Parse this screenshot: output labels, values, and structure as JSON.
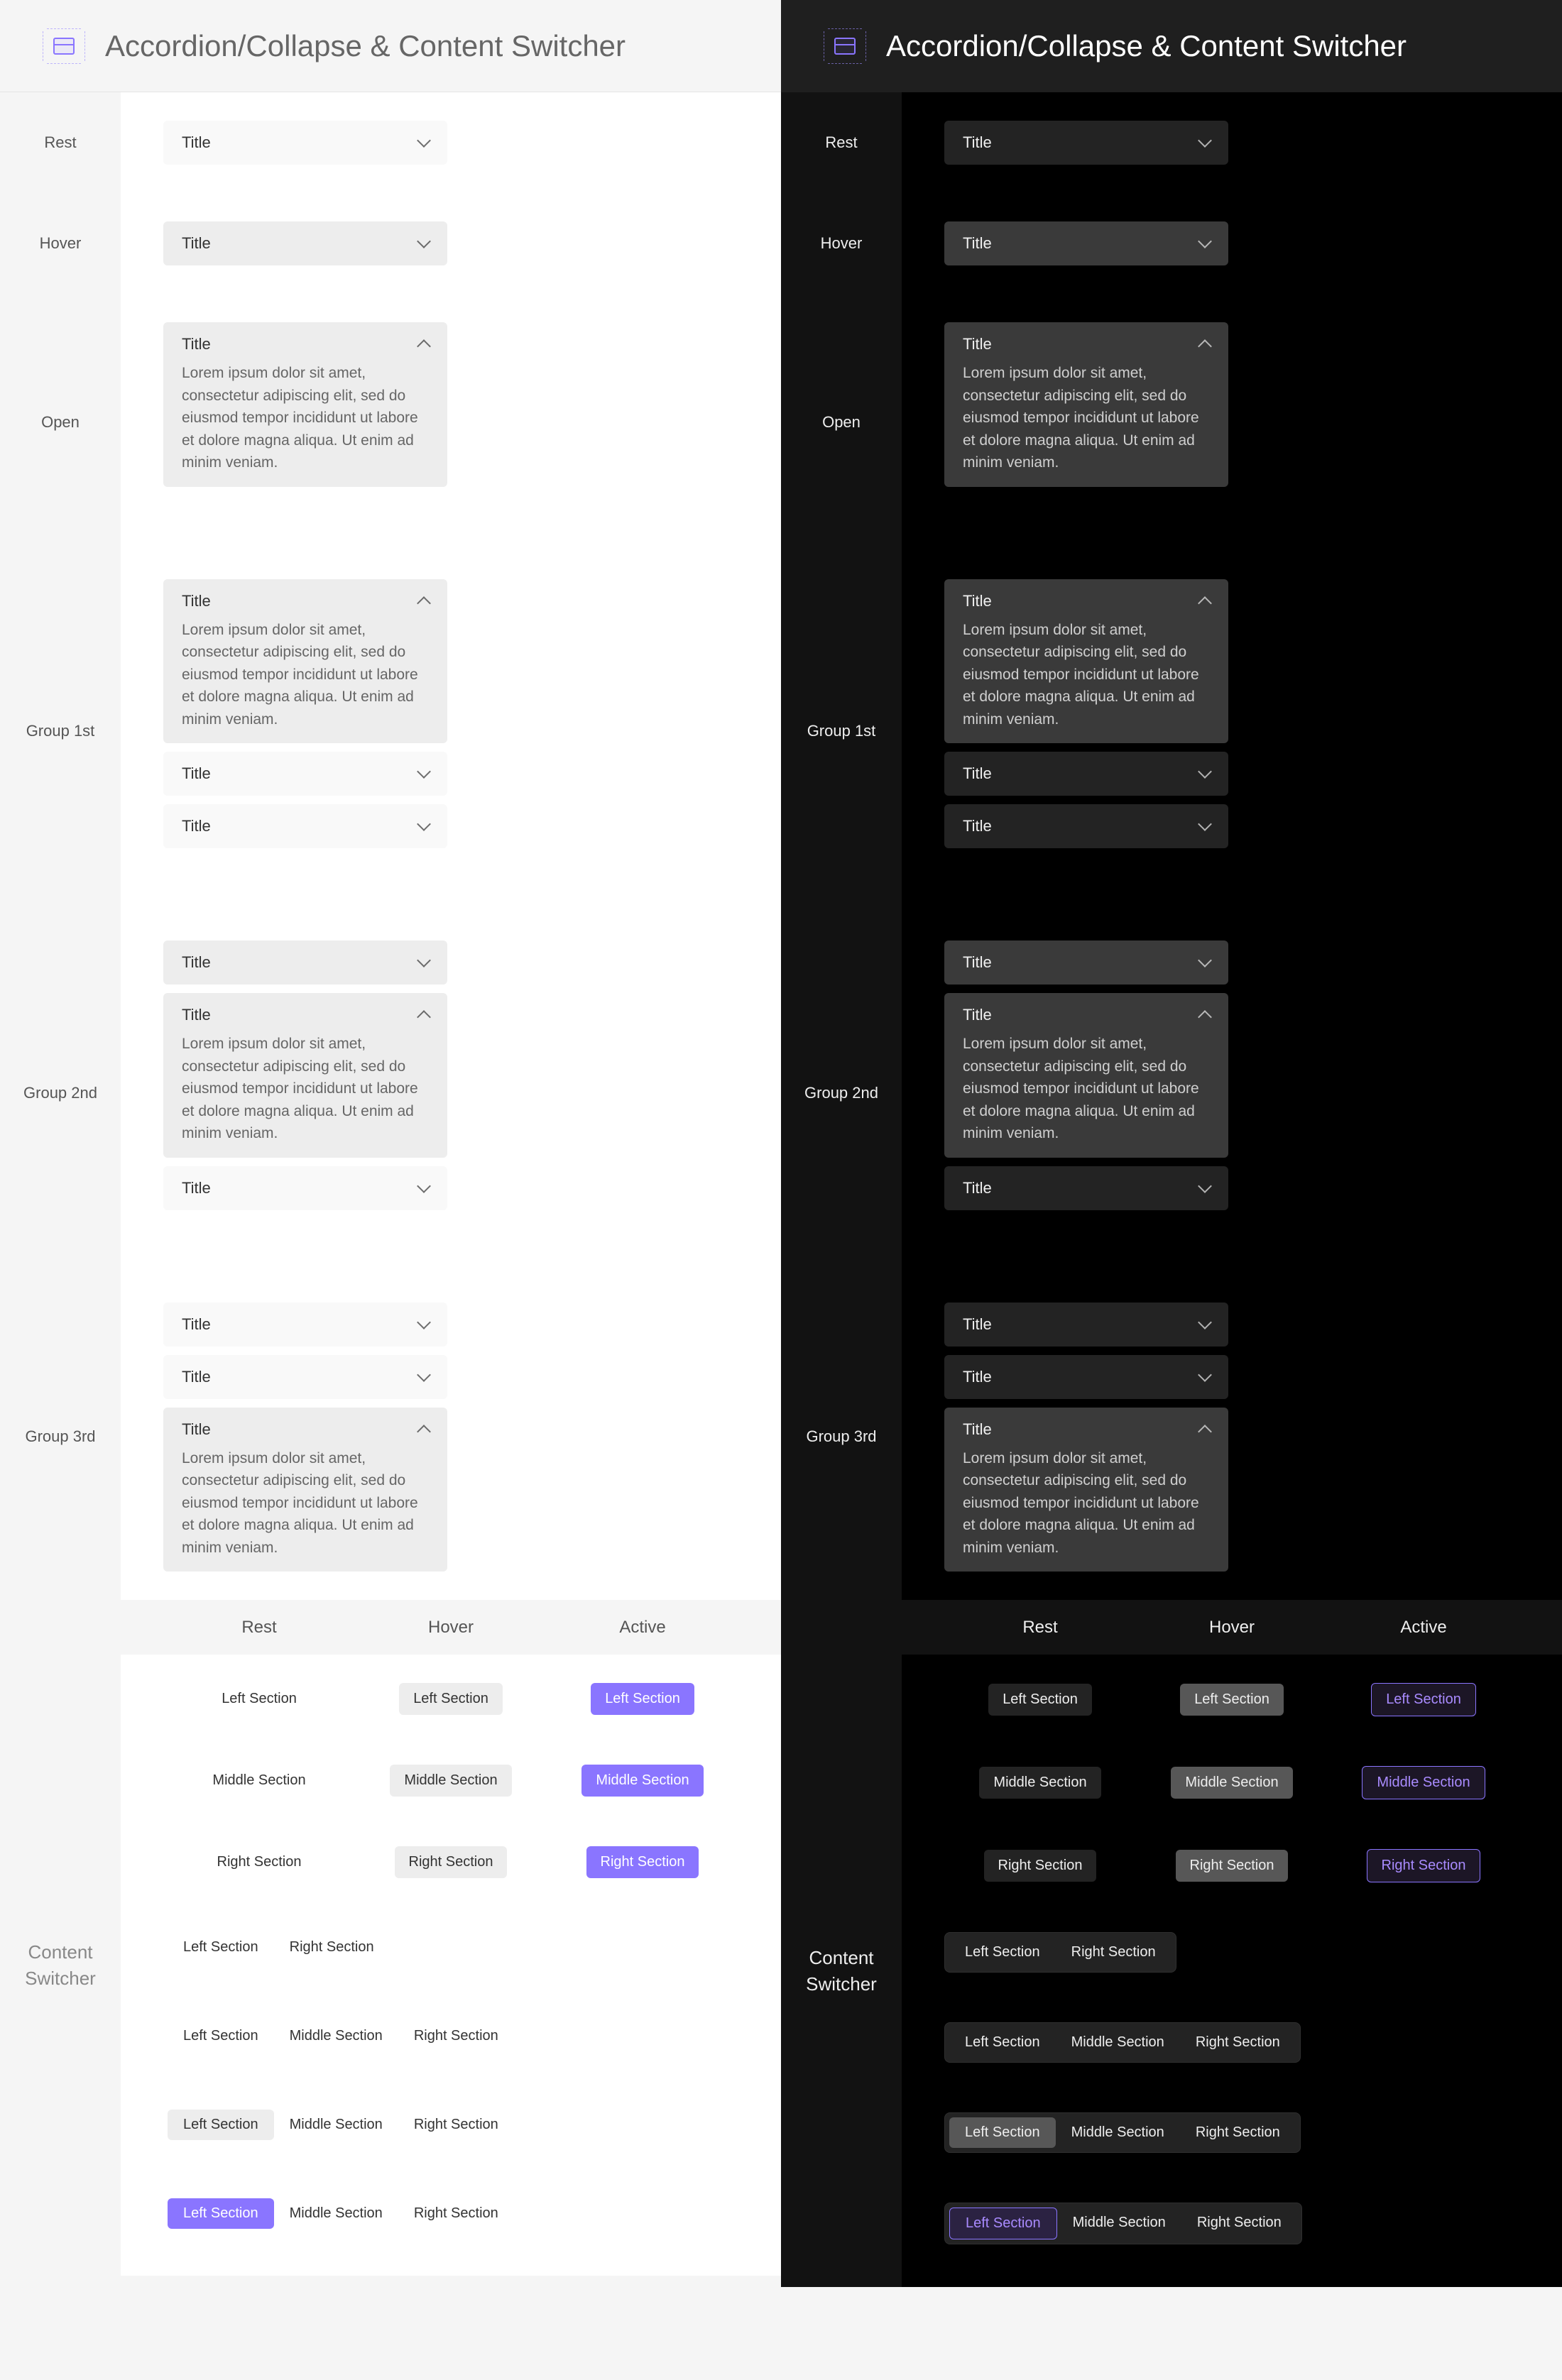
{
  "header": {
    "title": "Accordion/Collapse & Content Switcher"
  },
  "labels": {
    "rest": "Rest",
    "hover": "Hover",
    "open": "Open",
    "group1": "Group 1st",
    "group2": "Group 2nd",
    "group3": "Group 3rd",
    "active": "Active",
    "content_switcher": "Content Switcher"
  },
  "accordion": {
    "title": "Title",
    "body": "Lorem ipsum dolor sit amet, consectetur adipiscing elit, sed do eiusmod tempor incididunt ut labore et dolore magna aliqua. Ut enim ad minim veniam."
  },
  "switcher": {
    "left": "Left Section",
    "middle": "Middle Section",
    "right": "Right Section"
  },
  "colors": {
    "accent": "#8a75ff"
  }
}
